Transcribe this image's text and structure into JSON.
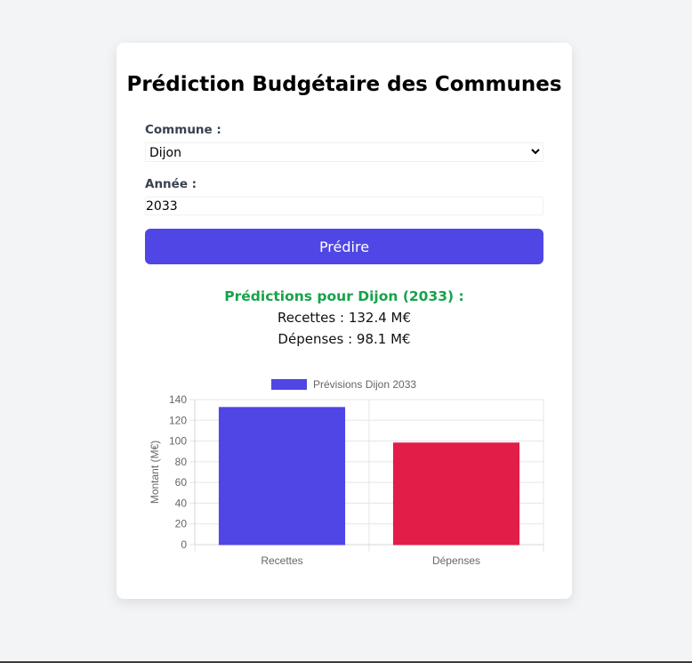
{
  "form": {
    "title": "Prédiction Budgétaire des Communes",
    "commune_label": "Commune :",
    "commune_value": "Dijon",
    "annee_label": "Année :",
    "annee_value": "2033",
    "submit_label": "Prédire"
  },
  "result": {
    "title": "Prédictions pour Dijon (2033) :",
    "recettes": "Recettes : 132.4 M€",
    "depenses": "Dépenses : 98.1 M€"
  },
  "colors": {
    "accent": "#4f46e5",
    "success": "#16a34a",
    "bar_recettes": "#4f46e5",
    "bar_depenses": "#e11d48"
  },
  "chart_data": {
    "type": "bar",
    "categories": [
      "Recettes",
      "Dépenses"
    ],
    "series": [
      {
        "name": "Prévisions Dijon 2033",
        "values": [
          132.4,
          98.1
        ],
        "colors": [
          "#4f46e5",
          "#e11d48"
        ]
      }
    ],
    "ylabel": "Montant (M€)",
    "xlabel": "",
    "ylim": [
      0,
      140
    ],
    "yticks": [
      0,
      20,
      40,
      60,
      80,
      100,
      120,
      140
    ],
    "legend": "top",
    "grid": true
  }
}
